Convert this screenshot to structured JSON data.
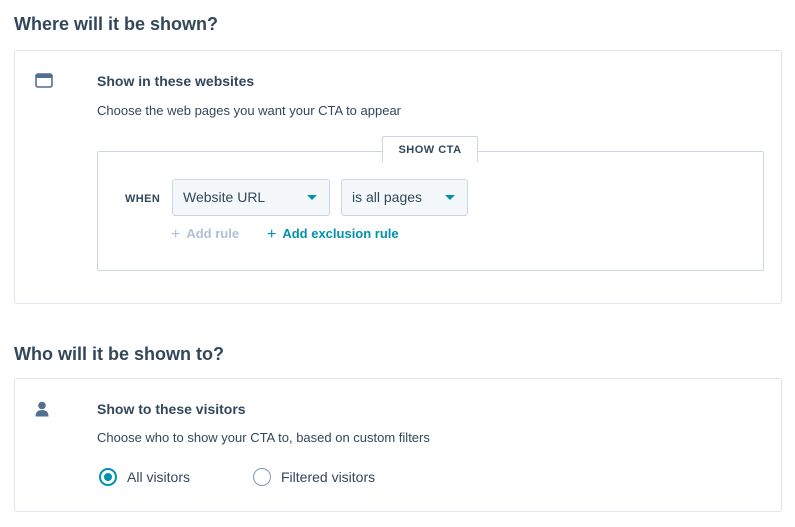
{
  "where_section": {
    "title": "Where will it be shown?",
    "card": {
      "icon": "browser-window-icon",
      "title": "Show in these websites",
      "description": "Choose the web pages you want your CTA to appear",
      "rule_tab_label": "SHOW CTA",
      "when_label": "WHEN",
      "condition_field": "Website URL",
      "condition_operator": "is all pages",
      "add_rule_label": "Add rule",
      "add_exclusion_label": "Add exclusion rule"
    }
  },
  "who_section": {
    "title": "Who will it be shown to?",
    "card": {
      "icon": "person-icon",
      "title": "Show to these visitors",
      "description": "Choose who to show your CTA to, based on custom filters",
      "options": [
        {
          "label": "All visitors",
          "selected": true
        },
        {
          "label": "Filtered visitors",
          "selected": false
        }
      ]
    }
  },
  "colors": {
    "text": "#33475b",
    "accent": "#0091ae",
    "border": "#cbd6e2",
    "disabled": "#b0c1d4"
  }
}
